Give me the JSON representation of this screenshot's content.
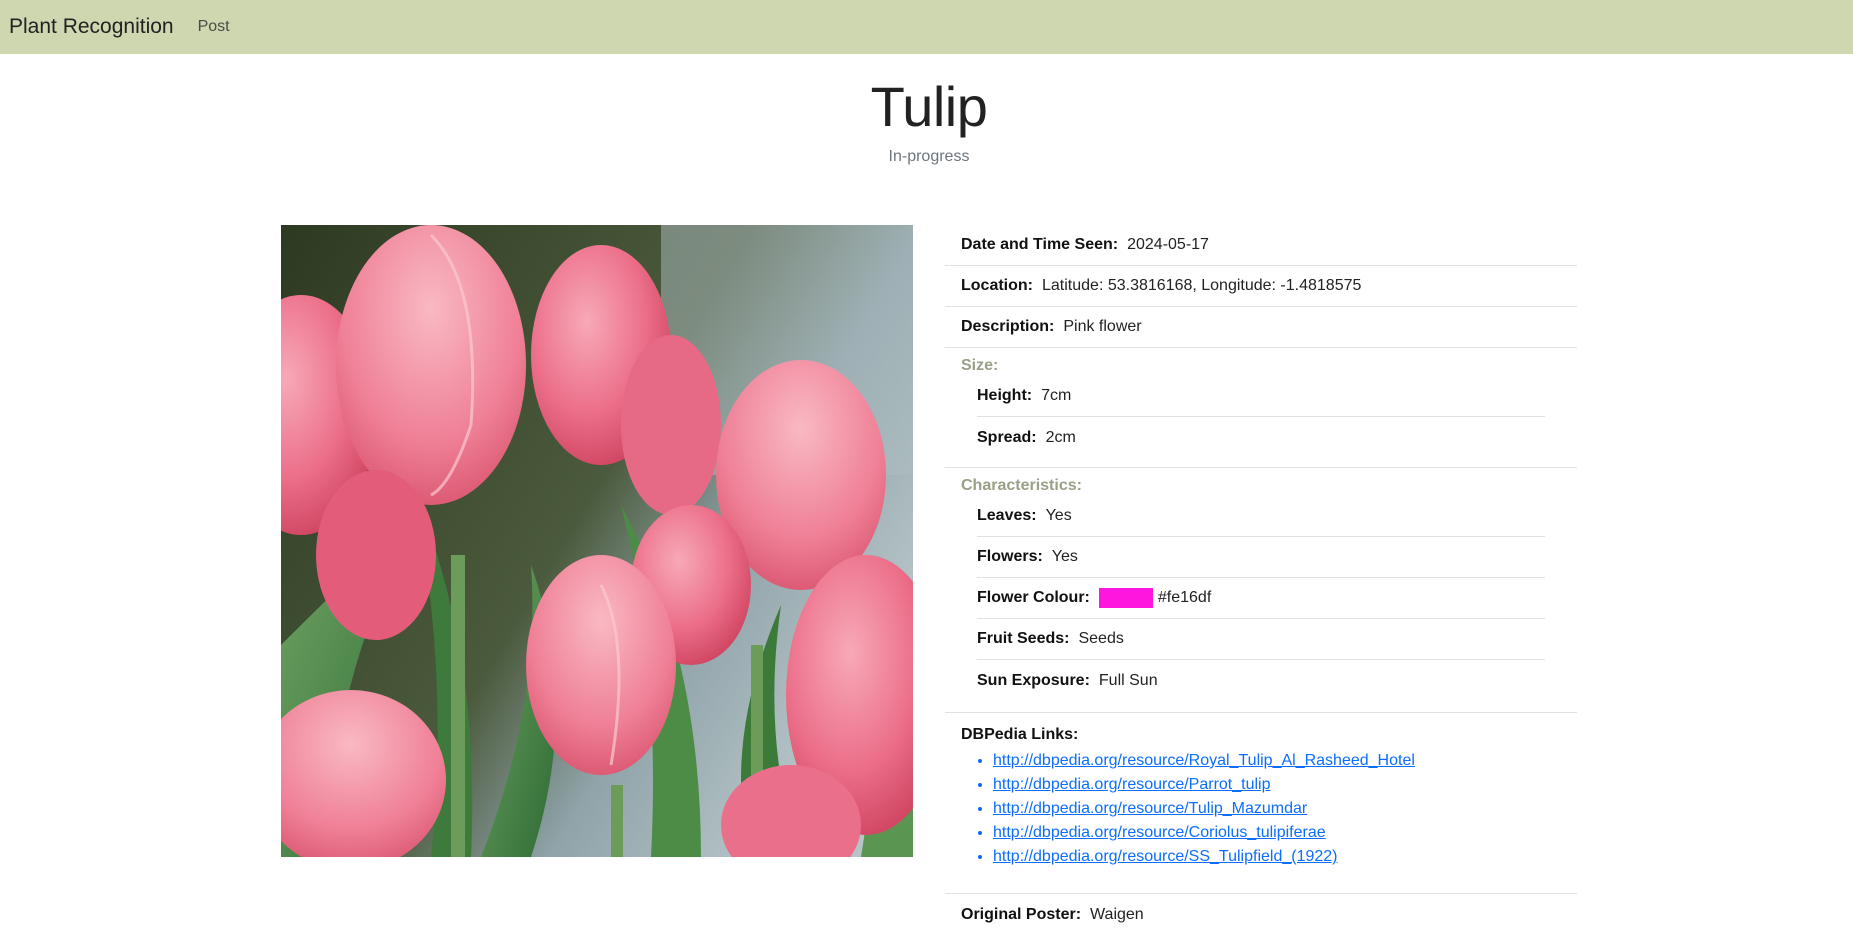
{
  "navbar": {
    "brand": "Plant Recognition",
    "post_link": "Post"
  },
  "plant": {
    "name": "Tulip",
    "status": "In-progress"
  },
  "details": {
    "date_label": "Date and Time Seen:",
    "date_value": "2024-05-17",
    "location_label": "Location:",
    "location_value": "Latitude: 53.3816168, Longitude: -1.4818575",
    "description_label": "Description:",
    "description_value": "Pink flower",
    "size": {
      "title": "Size:",
      "height_label": "Height:",
      "height_value": "7cm",
      "spread_label": "Spread:",
      "spread_value": "2cm"
    },
    "characteristics": {
      "title": "Characteristics:",
      "leaves_label": "Leaves:",
      "leaves_value": "Yes",
      "flowers_label": "Flowers:",
      "flowers_value": "Yes",
      "flower_colour_label": "Flower Colour:",
      "flower_colour_value": "#fe16df",
      "fruit_seeds_label": "Fruit Seeds:",
      "fruit_seeds_value": "Seeds",
      "sun_exposure_label": "Sun Exposure:",
      "sun_exposure_value": "Full Sun"
    },
    "dbpedia": {
      "title": "DBPedia Links:",
      "links": [
        "http://dbpedia.org/resource/Royal_Tulip_Al_Rasheed_Hotel",
        "http://dbpedia.org/resource/Parrot_tulip",
        "http://dbpedia.org/resource/Tulip_Mazumdar",
        "http://dbpedia.org/resource/Coriolus_tulipiferae",
        "http://dbpedia.org/resource/SS_Tulipfield_(1922)"
      ]
    },
    "poster_label": "Original Poster:",
    "poster_value": "Waigen"
  },
  "colors": {
    "navbar": "#cfd7b0",
    "group_title": "#98a086",
    "link": "#0d6efd",
    "swatch": "#fe16df"
  }
}
